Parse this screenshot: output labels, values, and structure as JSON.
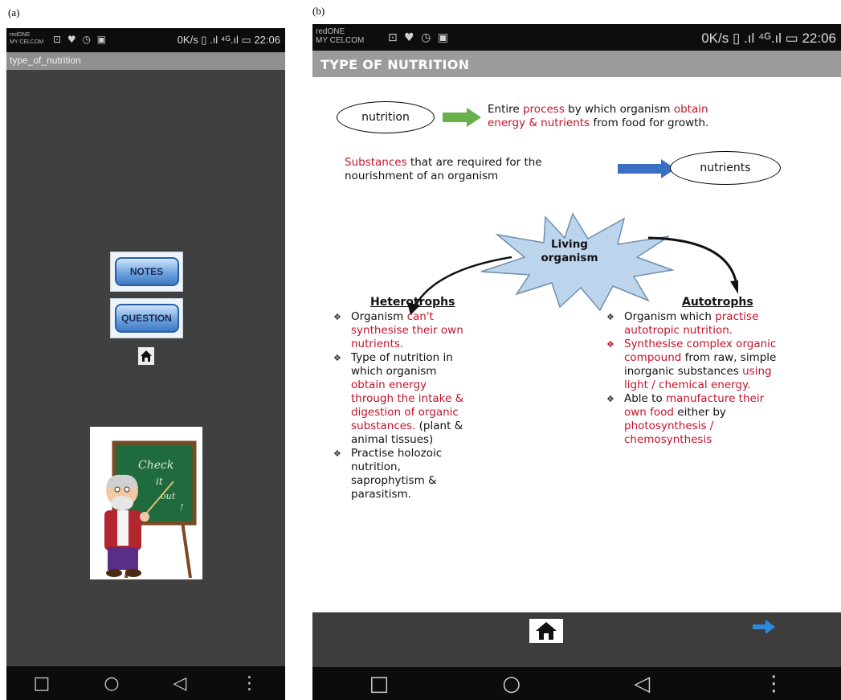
{
  "panels": {
    "a_label": "(a)",
    "b_label": "(b)"
  },
  "phone_a": {
    "status": {
      "carrier_line1": "redONE",
      "carrier_line2": "MY CELCOM",
      "icons": "⊡ ♥ ◷ ▣",
      "right": "0K/s ▯ .ıl ⁴ᴳ.ıl ▭ 22:06"
    },
    "app_title": "type_of_nutrition",
    "buttons": {
      "notes": "NOTES",
      "question": "QUESTION"
    },
    "teacher_board_text": "Check it out !",
    "icons": {
      "home": "home-icon",
      "nav_recent": "□",
      "nav_home": "○",
      "nav_back": "◁",
      "nav_menu": "⋮"
    }
  },
  "phone_b": {
    "status": {
      "carrier_line1": "redONE",
      "carrier_line2": "MY CELCOM",
      "icons": "⊡ ♥ ◷ ▣",
      "right": "0K/s ▯ .ıl ⁴ᴳ.ıl ▭ 22:06"
    },
    "page_title": "TYPE OF NUTRITION",
    "nutrition_term": "nutrition",
    "nutrition_def": {
      "p1": "Entire ",
      "p2": "process",
      "p3": " by which organism ",
      "p4": "obtain",
      "p5": "energy & nutrients",
      "p6": " from food for growth."
    },
    "nutrients_def": {
      "p1": "Substances",
      "p2": " that are required for the",
      "p3": "nourishment of an organism"
    },
    "nutrients_term": "nutrients",
    "burst_line1": "Living",
    "burst_line2": "organism",
    "heterotrophs": {
      "title": "Heterotrophs",
      "b1_p1": "Organism ",
      "b1_p2": "can't",
      "b1_p3": "synthesise their own",
      "b1_p4": "nutrients.",
      "b2_p1": "Type of nutrition in",
      "b2_p2": "which organism",
      "b2_p3": "obtain energy",
      "b2_p4": "through the intake &",
      "b2_p5": "digestion of organic",
      "b2_p6": "substances.",
      "b2_p7": " (plant &",
      "b2_p8": "animal tissues)",
      "b3_p1": "Practise holozoic",
      "b3_p2": "nutrition,",
      "b3_p3": "saprophytism &",
      "b3_p4": "parasitism."
    },
    "autotrophs": {
      "title": "Autotrophs",
      "b1_p1": "Organism which ",
      "b1_p2": "practise",
      "b1_p3": "autotropic nutrition.",
      "b2_p1": "Synthesise complex organic",
      "b2_p2": "compound",
      "b2_p3": " from raw, simple",
      "b2_p4": "inorganic substances ",
      "b2_p5": "using",
      "b2_p6": "light / chemical energy.",
      "b3_p1": "Able to ",
      "b3_p2": "manufacture their",
      "b3_p3": "own food",
      "b3_p4": " either by",
      "b3_p5": "photosynthesis /",
      "b3_p6": "chemosynthesis"
    },
    "icons": {
      "home": "home-icon",
      "next": "arrow-right-icon",
      "nav_recent": "□",
      "nav_home": "○",
      "nav_back": "◁",
      "nav_menu": "⋮"
    },
    "colors": {
      "accent_red": "#c0142b",
      "arrow_green": "#6ab04c",
      "arrow_blue": "#3a6fc4",
      "burst_fill": "#bcd5ec",
      "next_arrow": "#2b8be0"
    }
  }
}
